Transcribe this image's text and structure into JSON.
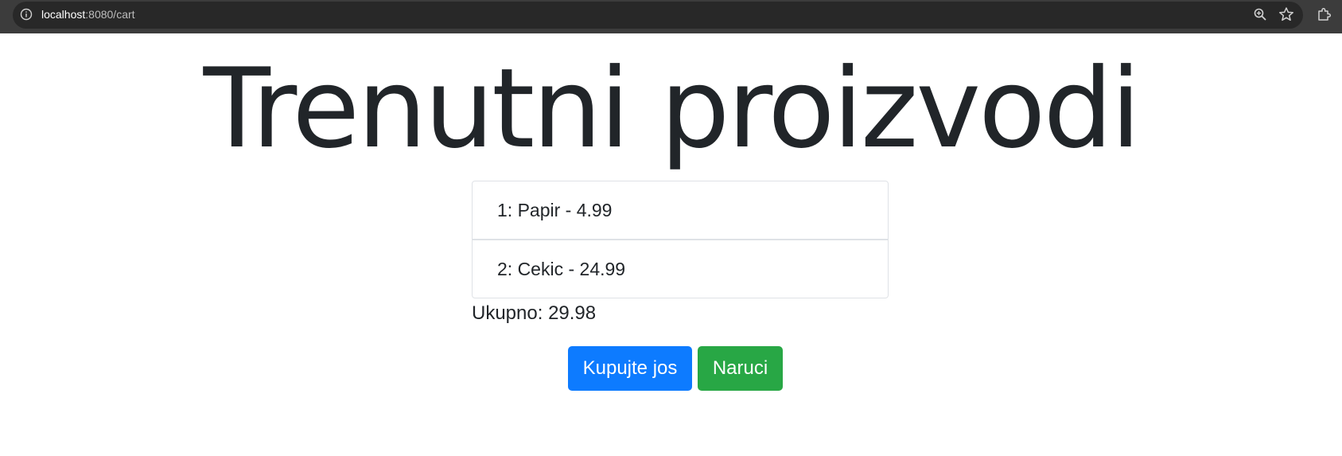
{
  "browser": {
    "url_host": "localhost",
    "url_path": ":8080/cart",
    "icons": [
      "info-icon",
      "zoom-icon",
      "star-icon",
      "extensions-icon"
    ]
  },
  "page": {
    "title": "Trenutni proizvodi"
  },
  "cart": {
    "items": [
      {
        "label": "1: Papir - 4.99"
      },
      {
        "label": "2: Cekic - 24.99"
      }
    ],
    "total_label": "Ukupno: ",
    "total_value": "29.98"
  },
  "actions": {
    "continue_label": "Kupujte jos",
    "order_label": "Naruci"
  },
  "colors": {
    "primary": "#0d7bff",
    "success": "#28a745",
    "text": "#212529"
  }
}
